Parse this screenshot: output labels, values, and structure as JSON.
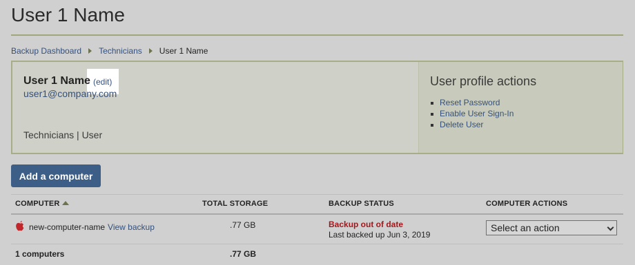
{
  "page": {
    "title": "User 1 Name"
  },
  "breadcrumb": {
    "items": [
      "Backup Dashboard",
      "Technicians"
    ],
    "current": "User 1 Name"
  },
  "profile": {
    "name": "User 1 Name",
    "edit_label": "(edit)",
    "email": "user1@company.com",
    "role_line": "Technicians | User"
  },
  "profile_actions": {
    "title": "User profile actions",
    "items": [
      "Reset Password",
      "Enable User Sign-In",
      "Delete User"
    ]
  },
  "add_computer_button": "Add a computer",
  "table": {
    "headers": [
      "COMPUTER",
      "TOTAL STORAGE",
      "BACKUP STATUS",
      "COMPUTER ACTIONS"
    ],
    "sort_column": "COMPUTER",
    "sort_direction": "ascending",
    "rows": [
      {
        "os_icon": "apple-icon",
        "name": "new-computer-name",
        "view_link": "View backup",
        "storage": ".77 GB",
        "status": "Backup out of date",
        "status_detail": "Last backed up Jun 3, 2019",
        "action_select": "Select an action"
      }
    ],
    "footer": {
      "count": "1 computers",
      "storage": ".77 GB"
    }
  },
  "colors": {
    "link": "#35507a",
    "accent_rule": "#9fa67e",
    "button": "#3d5f87",
    "error": "#a3181c"
  }
}
